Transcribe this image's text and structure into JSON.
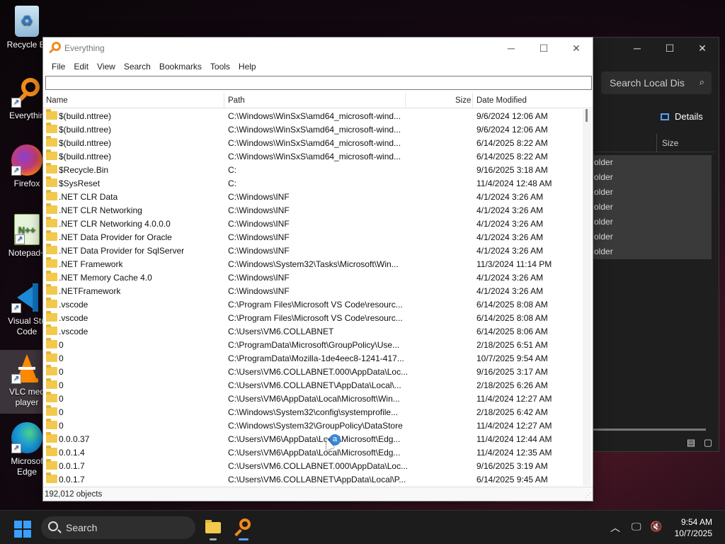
{
  "desktop": {
    "icons": [
      {
        "label": "Recycle Bi",
        "icon": "recycle-bin-icon"
      },
      {
        "label": "Everythin",
        "icon": "everything-search-icon"
      },
      {
        "label": "Firefox",
        "icon": "firefox-icon"
      },
      {
        "label": "Notepad+",
        "icon": "notepad-plus-plus-icon"
      },
      {
        "label": "Visual Stu",
        "label2": "Code",
        "icon": "vscode-icon"
      },
      {
        "label": "VLC med",
        "label2": "player",
        "icon": "vlc-icon"
      },
      {
        "label": "Microsof",
        "label2": "Edge",
        "icon": "edge-icon"
      }
    ]
  },
  "explorer": {
    "search_placeholder": "Search Local Dis",
    "details_label": "Details",
    "size_header": "Size",
    "rows": [
      "older",
      "older",
      "older",
      "older",
      "older",
      "older",
      "older"
    ]
  },
  "everything": {
    "title": "Everything",
    "menu": [
      "File",
      "Edit",
      "View",
      "Search",
      "Bookmarks",
      "Tools",
      "Help"
    ],
    "search_value": "",
    "columns": {
      "name": "Name",
      "path": "Path",
      "size": "Size",
      "date": "Date Modified"
    },
    "rows": [
      {
        "name": "$(build.nttree)",
        "path": "C:\\Windows\\WinSxS\\amd64_microsoft-wind...",
        "date": "9/6/2024 12:06 AM"
      },
      {
        "name": "$(build.nttree)",
        "path": "C:\\Windows\\WinSxS\\amd64_microsoft-wind...",
        "date": "9/6/2024 12:06 AM"
      },
      {
        "name": "$(build.nttree)",
        "path": "C:\\Windows\\WinSxS\\amd64_microsoft-wind...",
        "date": "6/14/2025 8:22 AM"
      },
      {
        "name": "$(build.nttree)",
        "path": "C:\\Windows\\WinSxS\\amd64_microsoft-wind...",
        "date": "6/14/2025 8:22 AM"
      },
      {
        "name": "$Recycle.Bin",
        "path": "C:",
        "date": "9/16/2025 3:18 AM"
      },
      {
        "name": "$SysReset",
        "path": "C:",
        "date": "11/4/2024 12:48 AM"
      },
      {
        "name": ".NET CLR Data",
        "path": "C:\\Windows\\INF",
        "date": "4/1/2024 3:26 AM"
      },
      {
        "name": ".NET CLR Networking",
        "path": "C:\\Windows\\INF",
        "date": "4/1/2024 3:26 AM"
      },
      {
        "name": ".NET CLR Networking 4.0.0.0",
        "path": "C:\\Windows\\INF",
        "date": "4/1/2024 3:26 AM"
      },
      {
        "name": ".NET Data Provider for Oracle",
        "path": "C:\\Windows\\INF",
        "date": "4/1/2024 3:26 AM"
      },
      {
        "name": ".NET Data Provider for SqlServer",
        "path": "C:\\Windows\\INF",
        "date": "4/1/2024 3:26 AM"
      },
      {
        "name": ".NET Framework",
        "path": "C:\\Windows\\System32\\Tasks\\Microsoft\\Win...",
        "date": "11/3/2024 11:14 PM"
      },
      {
        "name": ".NET Memory Cache 4.0",
        "path": "C:\\Windows\\INF",
        "date": "4/1/2024 3:26 AM"
      },
      {
        "name": ".NETFramework",
        "path": "C:\\Windows\\INF",
        "date": "4/1/2024 3:26 AM"
      },
      {
        "name": ".vscode",
        "path": "C:\\Program Files\\Microsoft VS Code\\resourc...",
        "date": "6/14/2025 8:08 AM"
      },
      {
        "name": ".vscode",
        "path": "C:\\Program Files\\Microsoft VS Code\\resourc...",
        "date": "6/14/2025 8:08 AM"
      },
      {
        "name": ".vscode",
        "path": "C:\\Users\\VM6.COLLABNET",
        "date": "6/14/2025 8:06 AM"
      },
      {
        "name": "0",
        "path": "C:\\ProgramData\\Microsoft\\GroupPolicy\\Use...",
        "date": "2/18/2025 6:51 AM"
      },
      {
        "name": "0",
        "path": "C:\\ProgramData\\Mozilla-1de4eec8-1241-417...",
        "date": "10/7/2025 9:54 AM"
      },
      {
        "name": "0",
        "path": "C:\\Users\\VM6.COLLABNET.000\\AppData\\Loc...",
        "date": "9/16/2025 3:17 AM"
      },
      {
        "name": "0",
        "path": "C:\\Users\\VM6.COLLABNET\\AppData\\Local\\...",
        "date": "2/18/2025 6:26 AM"
      },
      {
        "name": "0",
        "path": "C:\\Users\\VM6\\AppData\\Local\\Microsoft\\Win...",
        "date": "11/4/2024 12:27 AM"
      },
      {
        "name": "0",
        "path": "C:\\Windows\\System32\\config\\systemprofile...",
        "date": "2/18/2025 6:42 AM"
      },
      {
        "name": "0",
        "path": "C:\\Windows\\System32\\GroupPolicy\\DataStore",
        "date": "11/4/2024 12:27 AM"
      },
      {
        "name": "0.0.0.37",
        "path": "C:\\Users\\VM6\\AppData\\Local\\Microsoft\\Edg...",
        "date": "11/4/2024 12:44 AM"
      },
      {
        "name": "0.0.1.4",
        "path": "C:\\Users\\VM6\\AppData\\Local\\Microsoft\\Edg...",
        "date": "11/4/2024 12:35 AM"
      },
      {
        "name": "0.0.1.7",
        "path": "C:\\Users\\VM6.COLLABNET.000\\AppData\\Loc...",
        "date": "9/16/2025 3:19 AM"
      },
      {
        "name": "0.0.1.7",
        "path": "C:\\Users\\VM6.COLLABNET\\AppData\\Local\\P...",
        "date": "6/14/2025 9:45 AM"
      }
    ],
    "status": "192,012 objects"
  },
  "cursor_badge": "a",
  "taskbar": {
    "search_label": "Search",
    "time": "9:54 AM",
    "date": "10/7/2025"
  },
  "colors": {
    "accent": "#3aa0ff",
    "everything_orange": "#f08a1c",
    "folder_yellow": "#f2c94c"
  }
}
